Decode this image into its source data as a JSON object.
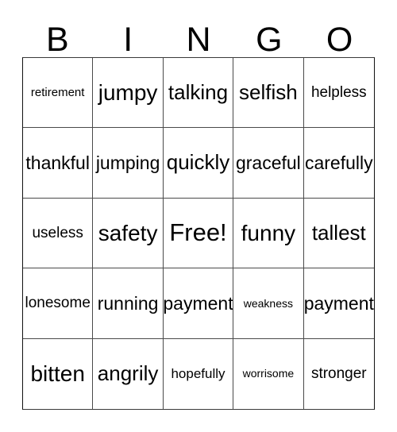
{
  "card": {
    "title": "BINGO",
    "header_letters": [
      "B",
      "I",
      "N",
      "G",
      "O"
    ],
    "free_space_label": "Free!",
    "colors": {
      "text": "#000000",
      "background": "#ffffff",
      "grid_line": "#4a4a4a",
      "outer_border": "#111111"
    },
    "grid": {
      "rows": 5,
      "columns": 5,
      "cells": [
        {
          "text": "retirement",
          "size": "xxs",
          "row": 1,
          "column": 1
        },
        {
          "text": "jumpy",
          "size": "xl",
          "row": 1,
          "column": 2
        },
        {
          "text": "talking",
          "size": "lg",
          "row": 1,
          "column": 3
        },
        {
          "text": "selfish",
          "size": "lg",
          "row": 1,
          "column": 4
        },
        {
          "text": "helpless",
          "size": "sm",
          "row": 1,
          "column": 5
        },
        {
          "text": "thankful",
          "size": "md",
          "row": 2,
          "column": 1
        },
        {
          "text": "jumping",
          "size": "md",
          "row": 2,
          "column": 2
        },
        {
          "text": "quickly",
          "size": "lg",
          "row": 2,
          "column": 3
        },
        {
          "text": "graceful",
          "size": "md",
          "row": 2,
          "column": 4
        },
        {
          "text": "carefully",
          "size": "md",
          "row": 2,
          "column": 5
        },
        {
          "text": "useless",
          "size": "sm",
          "row": 3,
          "column": 1
        },
        {
          "text": "safety",
          "size": "xl",
          "row": 3,
          "column": 2
        },
        {
          "text": "Free!",
          "size": "xxl",
          "row": 3,
          "column": 3
        },
        {
          "text": "funny",
          "size": "xl",
          "row": 3,
          "column": 4
        },
        {
          "text": "tallest",
          "size": "lg",
          "row": 3,
          "column": 5
        },
        {
          "text": "lonesome",
          "size": "sm",
          "row": 4,
          "column": 1
        },
        {
          "text": "running",
          "size": "md",
          "row": 4,
          "column": 2
        },
        {
          "text": "payment",
          "size": "md",
          "row": 4,
          "column": 3
        },
        {
          "text": "weakness",
          "size": "tiny",
          "row": 4,
          "column": 4
        },
        {
          "text": "payment",
          "size": "md",
          "row": 4,
          "column": 5
        },
        {
          "text": "bitten",
          "size": "xl",
          "row": 5,
          "column": 1
        },
        {
          "text": "angrily",
          "size": "lg",
          "row": 5,
          "column": 2
        },
        {
          "text": "hopefully",
          "size": "xs",
          "row": 5,
          "column": 3
        },
        {
          "text": "worrisome",
          "size": "tiny",
          "row": 5,
          "column": 4
        },
        {
          "text": "stronger",
          "size": "sm",
          "row": 5,
          "column": 5
        }
      ]
    }
  }
}
